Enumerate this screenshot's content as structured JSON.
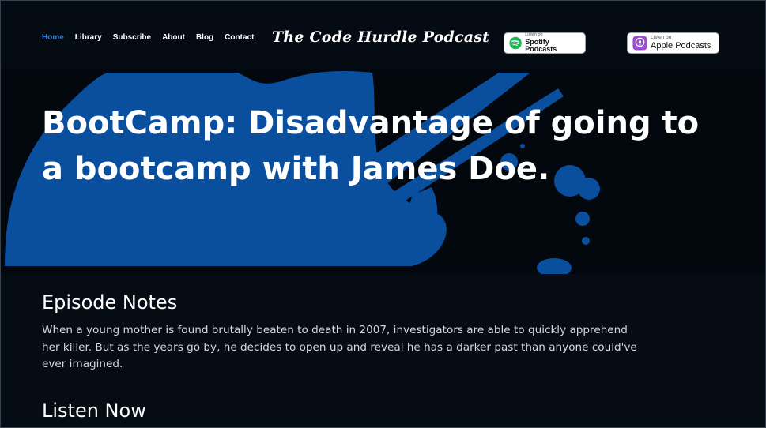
{
  "nav": {
    "items": [
      {
        "label": "Home",
        "active": true
      },
      {
        "label": "Library",
        "active": false
      },
      {
        "label": "Subscribe",
        "active": false
      },
      {
        "label": "About",
        "active": false
      },
      {
        "label": "Blog",
        "active": false
      },
      {
        "label": "Contact",
        "active": false
      }
    ],
    "active_color": "#2f7bdc"
  },
  "brand": {
    "title": "The Code Hurdle Podcast"
  },
  "badges": {
    "spotify": {
      "small": "Listen on",
      "big": "Spotify Podcasts",
      "icon": "spotify-icon",
      "color": "#1db954"
    },
    "apple": {
      "small": "Listen on",
      "big": "Apple Podcasts",
      "icon": "apple-podcasts-icon",
      "color": "#9b4fd0"
    }
  },
  "hero": {
    "title": "BootCamp: Disadvantage of going to a bootcamp with James Doe.",
    "accent_color": "#0a4e9e"
  },
  "episode": {
    "notes_heading": "Episode Notes",
    "notes_body": "When a young mother is found brutally beaten to death in 2007, investigators are able to quickly apprehend her killer. But as the years go by, he decides to open up and reveal he has a darker past than anyone could've ever imagined.",
    "listen_heading": "Listen Now"
  }
}
